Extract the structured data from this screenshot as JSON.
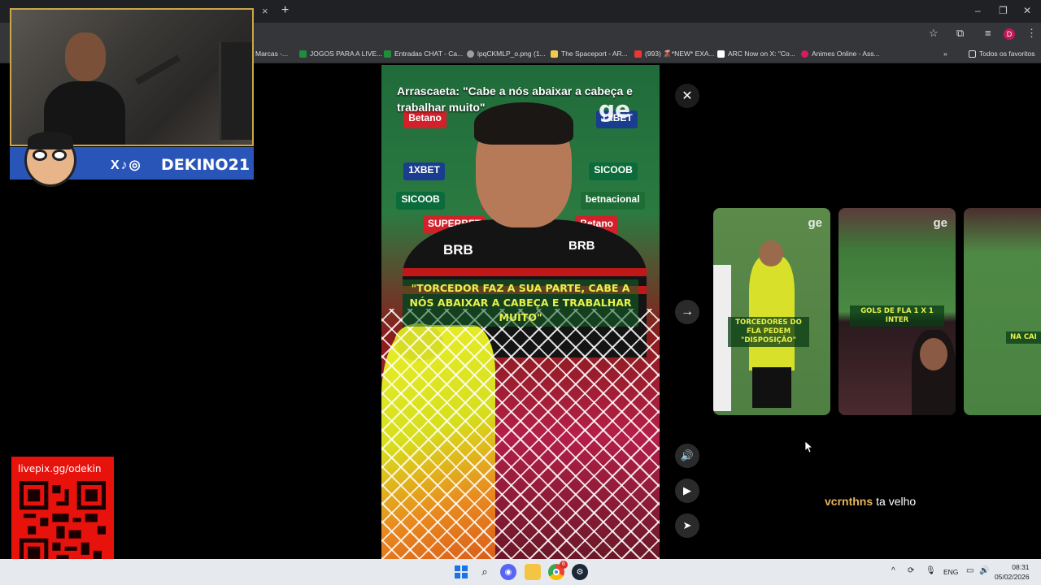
{
  "browser": {
    "close_tab_glyph": "×",
    "new_tab_glyph": "+",
    "window_controls": [
      "–",
      "❐",
      "✕"
    ],
    "toolbar_icons": [
      "star-icon",
      "extensions-icon",
      "media-icon",
      "menu-icon"
    ],
    "profile_initial": "D",
    "bookmarks": [
      {
        "label": "Marcas -...",
        "color": "#9e9e9e"
      },
      {
        "label": "JOGOS PARA A LIVE...",
        "color": "#1e8e3e"
      },
      {
        "label": "Entradas CHAT - Ca...",
        "color": "#1e8e3e"
      },
      {
        "label": "lpqCKMLP_o.png (1...",
        "color": "#9aa0a6"
      },
      {
        "label": "The Spaceport - AR...",
        "color": "#f2c94c"
      },
      {
        "label": "(993) 🌋*NEW* EXA...",
        "color": "#e53935"
      },
      {
        "label": "ARC Now on X: \"Co...",
        "color": "#111111"
      },
      {
        "label": "Animes Online - Ass...",
        "color": "#d81b60"
      }
    ],
    "bookmarks_overflow": "»",
    "all_bookmarks": "Todos os favoritos"
  },
  "stream": {
    "handle": "DEKINO21",
    "social_icons": "X♪◎",
    "qr_label": "livepix.gg/odekin"
  },
  "video": {
    "title": "Arrascaeta: \"Cabe a nós abaixar a cabeça e trabalhar muito\"",
    "quote": "\"TORCEDOR FAZ A SUA PARTE, CABE A NÓS ABAIXAR A CABEÇA E TRABALHAR MUITO\"",
    "watermark": "ge",
    "sponsor_labels": [
      "Betano",
      "SICOOB",
      "1XBET",
      "SUPERBET",
      "betnacional",
      "BRB"
    ]
  },
  "controls": {
    "close": "✕",
    "next": "→",
    "volume": "🔊",
    "play": "▶",
    "share": "➤"
  },
  "thumbnails": [
    {
      "caption": "TORCEDORES DO FLA PEDEM \"DISPOSIÇÃO\"",
      "watermark": "ge"
    },
    {
      "caption": "GOLS DE FLA 1 X 1 INTER",
      "watermark": "ge"
    },
    {
      "caption": "NA CAI",
      "watermark": ""
    }
  ],
  "chat": {
    "user": "vcrnthns",
    "message": "ta velho"
  },
  "taskbar": {
    "apps": [
      "windows-start",
      "search",
      "discord",
      "file-explorer",
      "chrome",
      "steam"
    ],
    "chrome_badge": "6",
    "tray": [
      "^",
      "ENG"
    ],
    "time": "08:31",
    "date": "05/02/2026"
  }
}
